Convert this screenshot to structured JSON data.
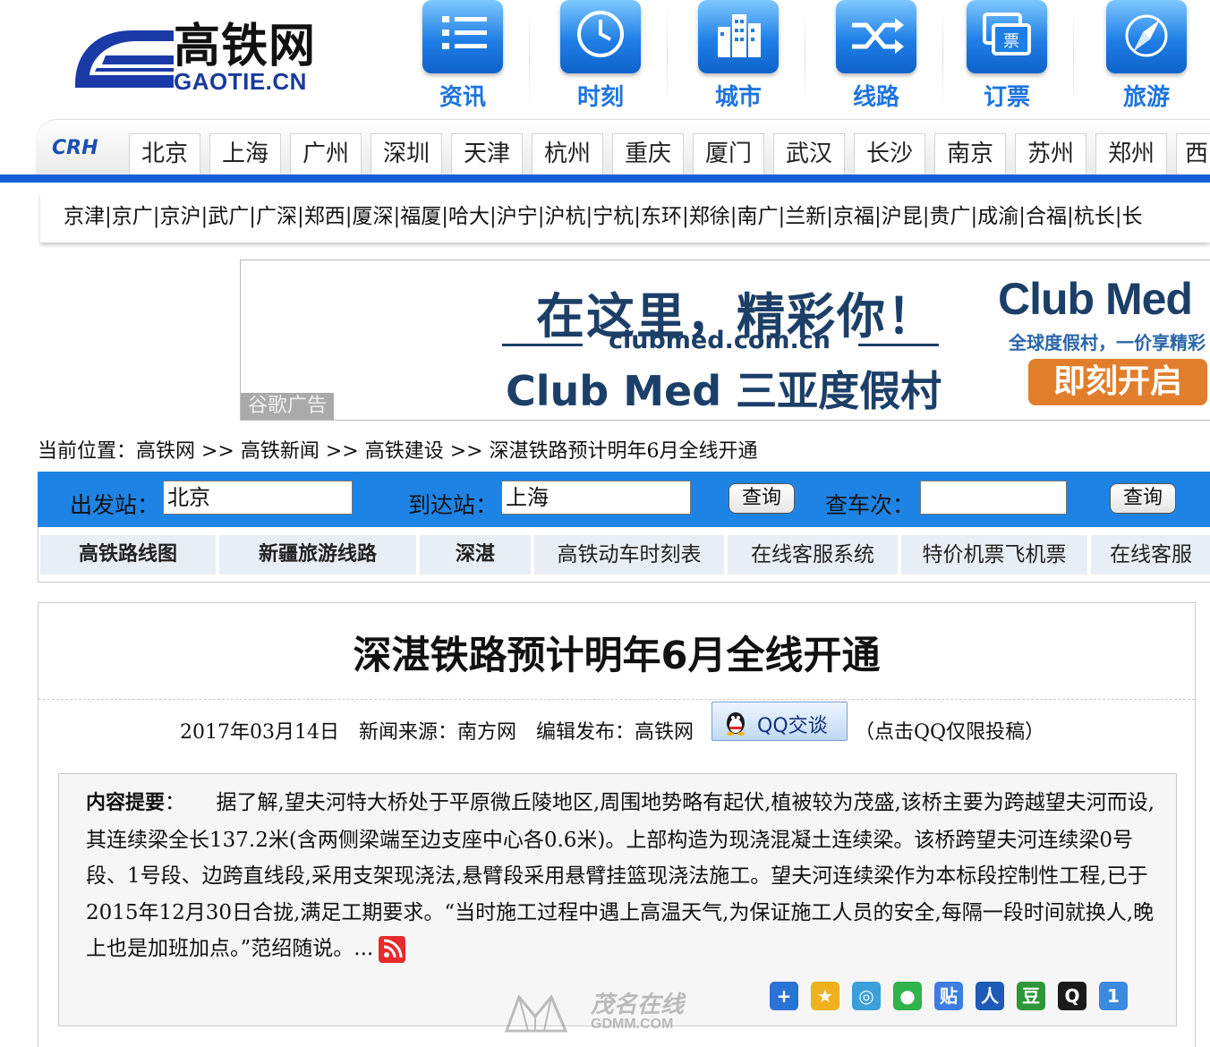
{
  "site": {
    "logo_cn": "高铁网",
    "logo_en": "GAOTIE.CN",
    "brand_color": "#1560d8"
  },
  "top_nav": [
    {
      "label": "资讯",
      "icon": "list-icon"
    },
    {
      "label": "时刻",
      "icon": "clock-icon"
    },
    {
      "label": "城市",
      "icon": "buildings-icon"
    },
    {
      "label": "线路",
      "icon": "shuffle-icon"
    },
    {
      "label": "订票",
      "icon": "ticket-icon"
    },
    {
      "label": "旅游",
      "icon": "compass-icon"
    }
  ],
  "city_bar": {
    "badge": "CRH",
    "cities": [
      "北京",
      "上海",
      "广州",
      "深圳",
      "天津",
      "杭州",
      "重庆",
      "厦门",
      "武汉",
      "长沙",
      "南京",
      "苏州",
      "郑州",
      "西"
    ]
  },
  "line_bar": {
    "text": "京津|京广|京沪|武广|广深|郑西|厦深|福厦|哈大|沪宁|沪杭|宁杭|东环|郑徐|南广|兰新|京福|沪昆|贵广|成渝|合福|杭长|长"
  },
  "ad": {
    "headline": "在这里，精彩你！",
    "url": "clubmed.com.cn",
    "subheadline": "Club Med 三亚度假村",
    "brand": "Club Med",
    "tagline": "全球度假村，一价享精彩",
    "cta": "即刻开启",
    "label": "谷歌广告",
    "cta_color": "#e17e2c"
  },
  "breadcrumb": "当前位置：高铁网 >> 高铁新闻 >> 高铁建设 >> 深湛铁路预计明年6月全线开通",
  "search": {
    "from_label": "出发站：",
    "from_value": "北京",
    "to_label": "到达站：",
    "to_value": "上海",
    "query_button": "查询",
    "train_label": "查车次：",
    "train_value": "",
    "query_button_2": "查询",
    "bar_color": "#1d84e6"
  },
  "quick_links": [
    "高铁路线图",
    "新疆旅游线路",
    "深湛",
    "高铁动车时刻表",
    "在线客服系统",
    "特价机票飞机票",
    "在线客服"
  ],
  "article": {
    "title": "深湛铁路预计明年6月全线开通",
    "meta": "2017年03月14日　新闻来源：南方网　编辑发布：高铁网",
    "qq_button": "QQ交谈",
    "qq_note": "（点击QQ仅限投稿）",
    "summary_label": "内容提要",
    "summary_text": "：　　据了解,望夫河特大桥处于平原微丘陵地区,周围地势略有起伏,植被较为茂盛,该桥主要为跨越望夫河而设,其连续梁全长137.2米(含两侧梁端至边支座中心各0.6米)。上部构造为现浇混凝土连续梁。该桥跨望夫河连续梁0号段、1号段、边跨直线段,采用支架现浇法,悬臂段采用悬臂挂篮现浇法施工。望夫河连续梁作为本标段控制性工程,已于2015年12月30日合拢,满足工期要求。“当时施工过程中遇上高温天气,为保证施工人员的安全,每隔一段时间就换人,晚上也是加班加点。”范绍随说。..."
  },
  "share_icons": [
    {
      "name": "share-plus-icon",
      "glyph": "+",
      "color": "#2a72d4"
    },
    {
      "name": "share-qzone-icon",
      "glyph": "★",
      "color": "#f0b21c"
    },
    {
      "name": "share-pengyou-icon",
      "glyph": "◎",
      "color": "#3ba0d8"
    },
    {
      "name": "share-wechat-icon",
      "glyph": "●",
      "color": "#2fb34a"
    },
    {
      "name": "share-tieba-icon",
      "glyph": "贴",
      "color": "#3d7ee0"
    },
    {
      "name": "share-renren-icon",
      "glyph": "人",
      "color": "#1e5bb8"
    },
    {
      "name": "share-douban-icon",
      "glyph": "豆",
      "color": "#2d963a"
    },
    {
      "name": "share-qq-icon",
      "glyph": "Q",
      "color": "#1a1a1a"
    },
    {
      "name": "share-kaixin-icon",
      "glyph": "1",
      "color": "#3a8ae0"
    }
  ],
  "watermark": {
    "text": "茂名在线",
    "sub": "GDMM.COM"
  }
}
